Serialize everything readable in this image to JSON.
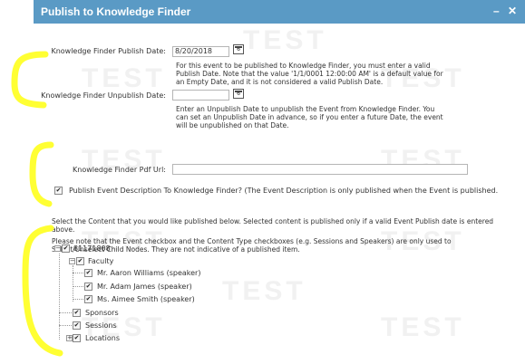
{
  "dialog": {
    "title": "Publish to Knowledge Finder",
    "controls": "– ✕"
  },
  "watermark": "TEST",
  "form": {
    "publish_date_label": "Knowledge Finder Publish Date:",
    "publish_date_value": "8/20/2018",
    "publish_date_help": [
      "For this event to be published to Knowledge Finder, you must enter a valid",
      "Publish Date. Note that the value '1/1/0001 12:00:00 AM' is a default value for",
      "an Empty Date, and it is not considered a valid Publish Date."
    ],
    "unpublish_date_label": "Knowledge Finder Unpublish Date:",
    "unpublish_date_value": "",
    "unpublish_date_help": [
      "Enter an Unpublish Date to unpublish the Event from Knowledge Finder. You",
      "can set an Unpublish Date in advance, so if you enter a future Date, the event",
      "will be unpublished on that Date."
    ],
    "calendar_icon_text": "6",
    "pdf_url_label": "Knowledge Finder Pdf Url:",
    "pdf_url_value": "",
    "publish_description_label": "Publish Event Description To Knowledge Finder? (The Event Description is only published when the Event is published.",
    "publish_description_checked": true
  },
  "info": {
    "select_content": [
      "Select the Content that you would like published below. Selected content is published only if a valid Event Publish date is entered",
      "above."
    ],
    "note": [
      "Please note that the Event checkbox and the Content Type checkboxes (e.g. Sessions and Speakers) are only used to",
      "Select/Unselect Child Nodes. They are not indicative of a published item."
    ]
  },
  "tree": {
    "root": "81171808",
    "faculty": "Faculty",
    "speakers": [
      "Mr. Aaron Williams (speaker)",
      "Mr. Adam James (speaker)",
      "Ms. Aimee Smith (speaker)"
    ],
    "sponsors": "Sponsors",
    "sessions": "Sessions",
    "locations": "Locations"
  },
  "colors": {
    "titlebar": "#5a9ac5",
    "highlight": "#ffff33"
  }
}
